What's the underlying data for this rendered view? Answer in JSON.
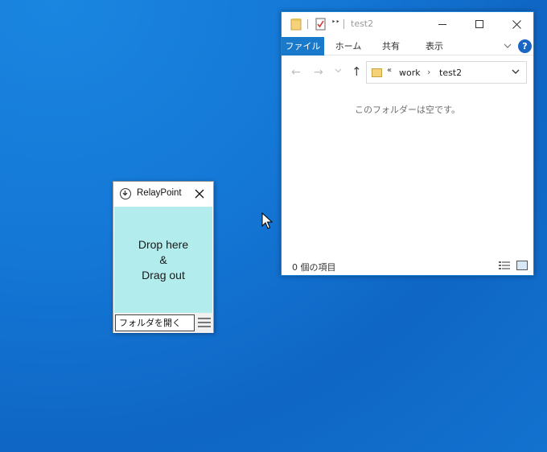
{
  "explorer": {
    "title": "test2",
    "quick_access_more": "‣‣",
    "ribbon": {
      "file": "ファイル",
      "home": "ホーム",
      "share": "共有",
      "view": "表示"
    },
    "address": {
      "chevrons": "«",
      "parent": "work",
      "separator": "›",
      "current": "test2"
    },
    "empty_message": "このフォルダーは空です。",
    "item_count": "0 個の項目",
    "colors": {
      "accent": "#1979ca",
      "help": "#1966c5"
    }
  },
  "relay": {
    "title": "RelayPoint",
    "dropzone_lines": [
      "Drop here",
      "&",
      "Drag out"
    ],
    "open_folder": "フォルダを開く",
    "colors": {
      "dropzone": "#b3ecec"
    }
  },
  "icons": [
    "folder-icon",
    "properties-icon",
    "minimize-icon",
    "maximize-icon",
    "close-icon",
    "help-icon",
    "back-arrow-icon",
    "forward-arrow-icon",
    "up-arrow-icon",
    "dropdown-chevron-icon",
    "details-view-icon",
    "tiles-view-icon",
    "relaypoint-logo-icon",
    "hamburger-menu-icon",
    "mouse-cursor-icon"
  ]
}
